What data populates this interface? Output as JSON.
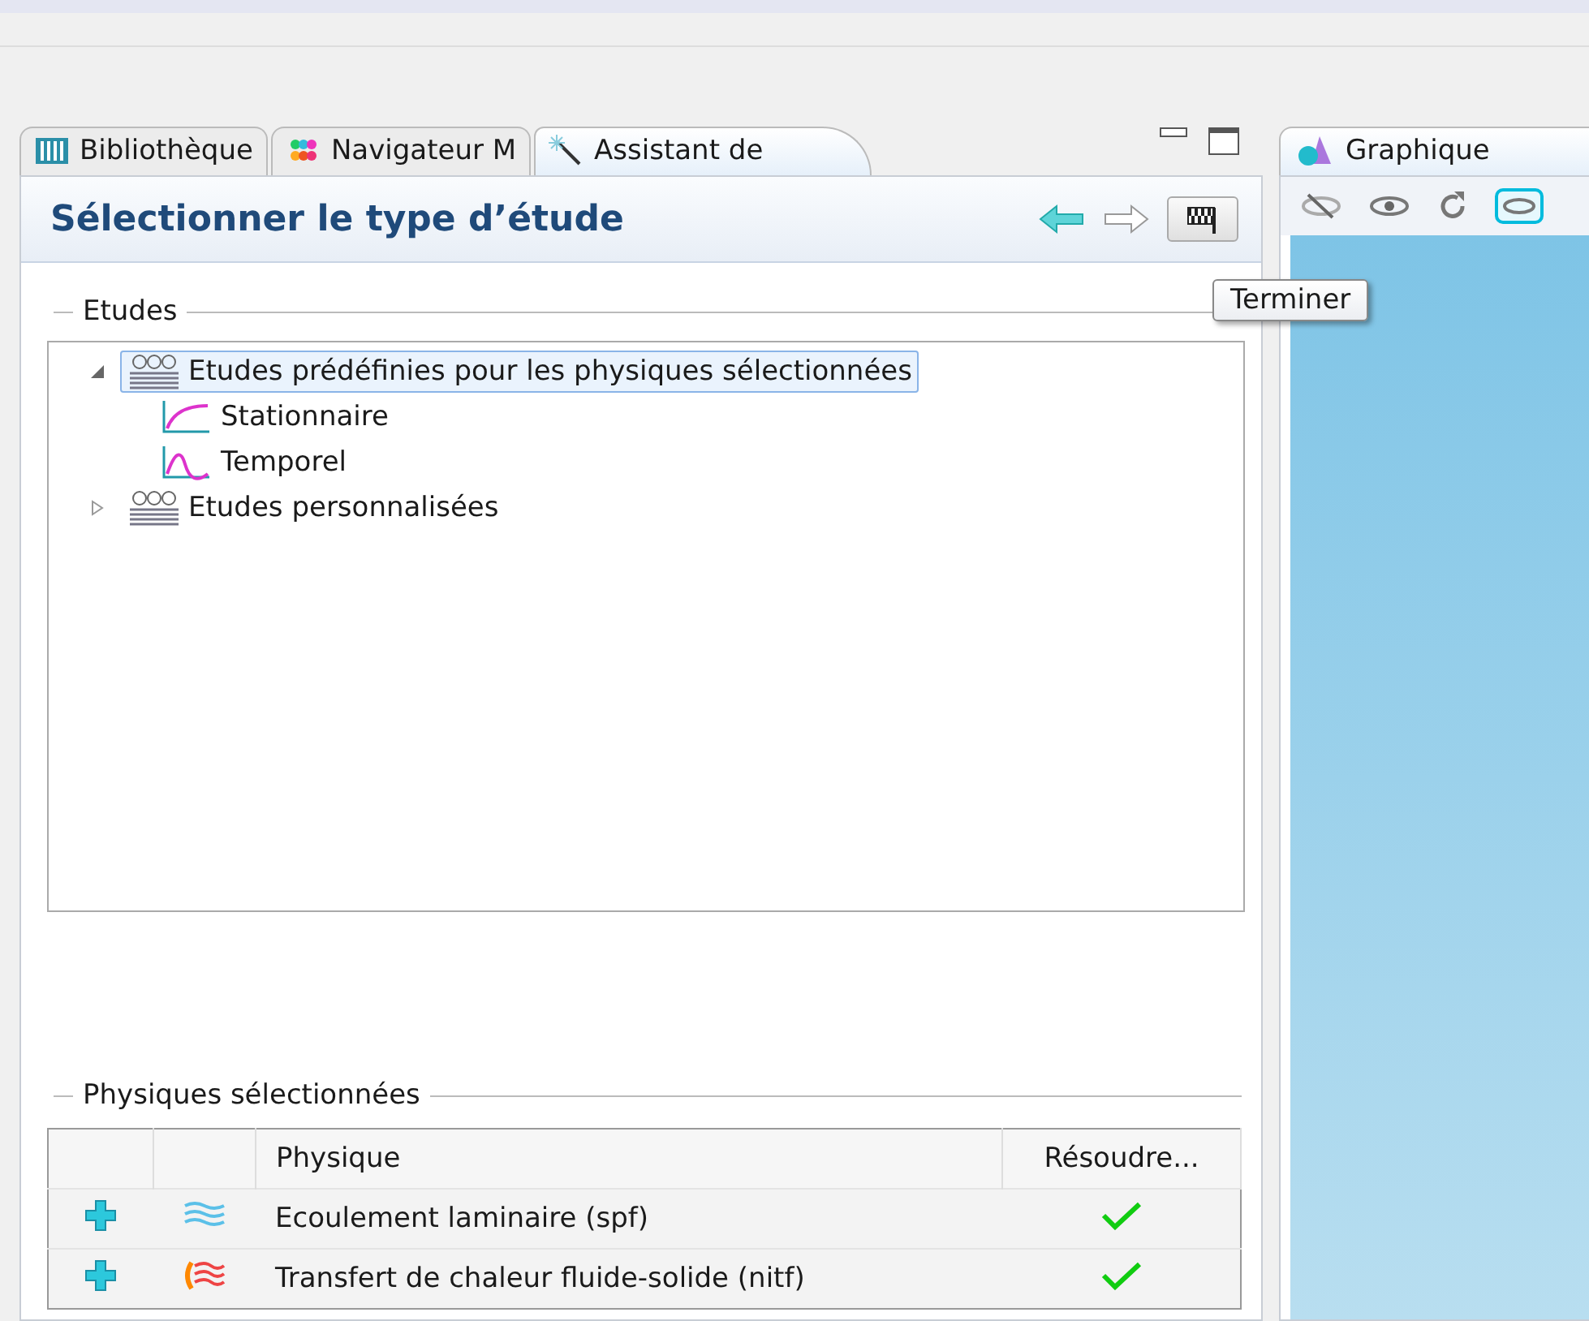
{
  "left_panel": {
    "tabs": [
      {
        "label": "Bibliothèque",
        "selected": false
      },
      {
        "label": "Navigateur M",
        "selected": false
      },
      {
        "label": "Assistant de",
        "selected": true
      }
    ],
    "header": {
      "title": "Sélectionner le type d’étude",
      "back_enabled": true,
      "forward_enabled": false
    },
    "tooltip": "Terminer",
    "studies": {
      "label": "Etudes",
      "tree": [
        {
          "label": "Etudes prédéfinies pour les physiques sélectionnées",
          "expanded": true,
          "selected": true,
          "children": [
            {
              "label": "Stationnaire",
              "selected": false
            },
            {
              "label": "Temporel",
              "selected": false
            }
          ]
        },
        {
          "label": "Etudes personnalisées",
          "expanded": false,
          "selected": false
        }
      ]
    },
    "physics": {
      "label": "Physiques sélectionnées",
      "columns": [
        "Physique",
        "Résoudre..."
      ],
      "rows": [
        {
          "name": "Ecoulement laminaire (spf)",
          "solve": true
        },
        {
          "name": "Transfert de chaleur fluide-solide (nitf)",
          "solve": true
        }
      ]
    }
  },
  "right_panel": {
    "tab": {
      "label": "Graphique",
      "selected": true
    }
  }
}
